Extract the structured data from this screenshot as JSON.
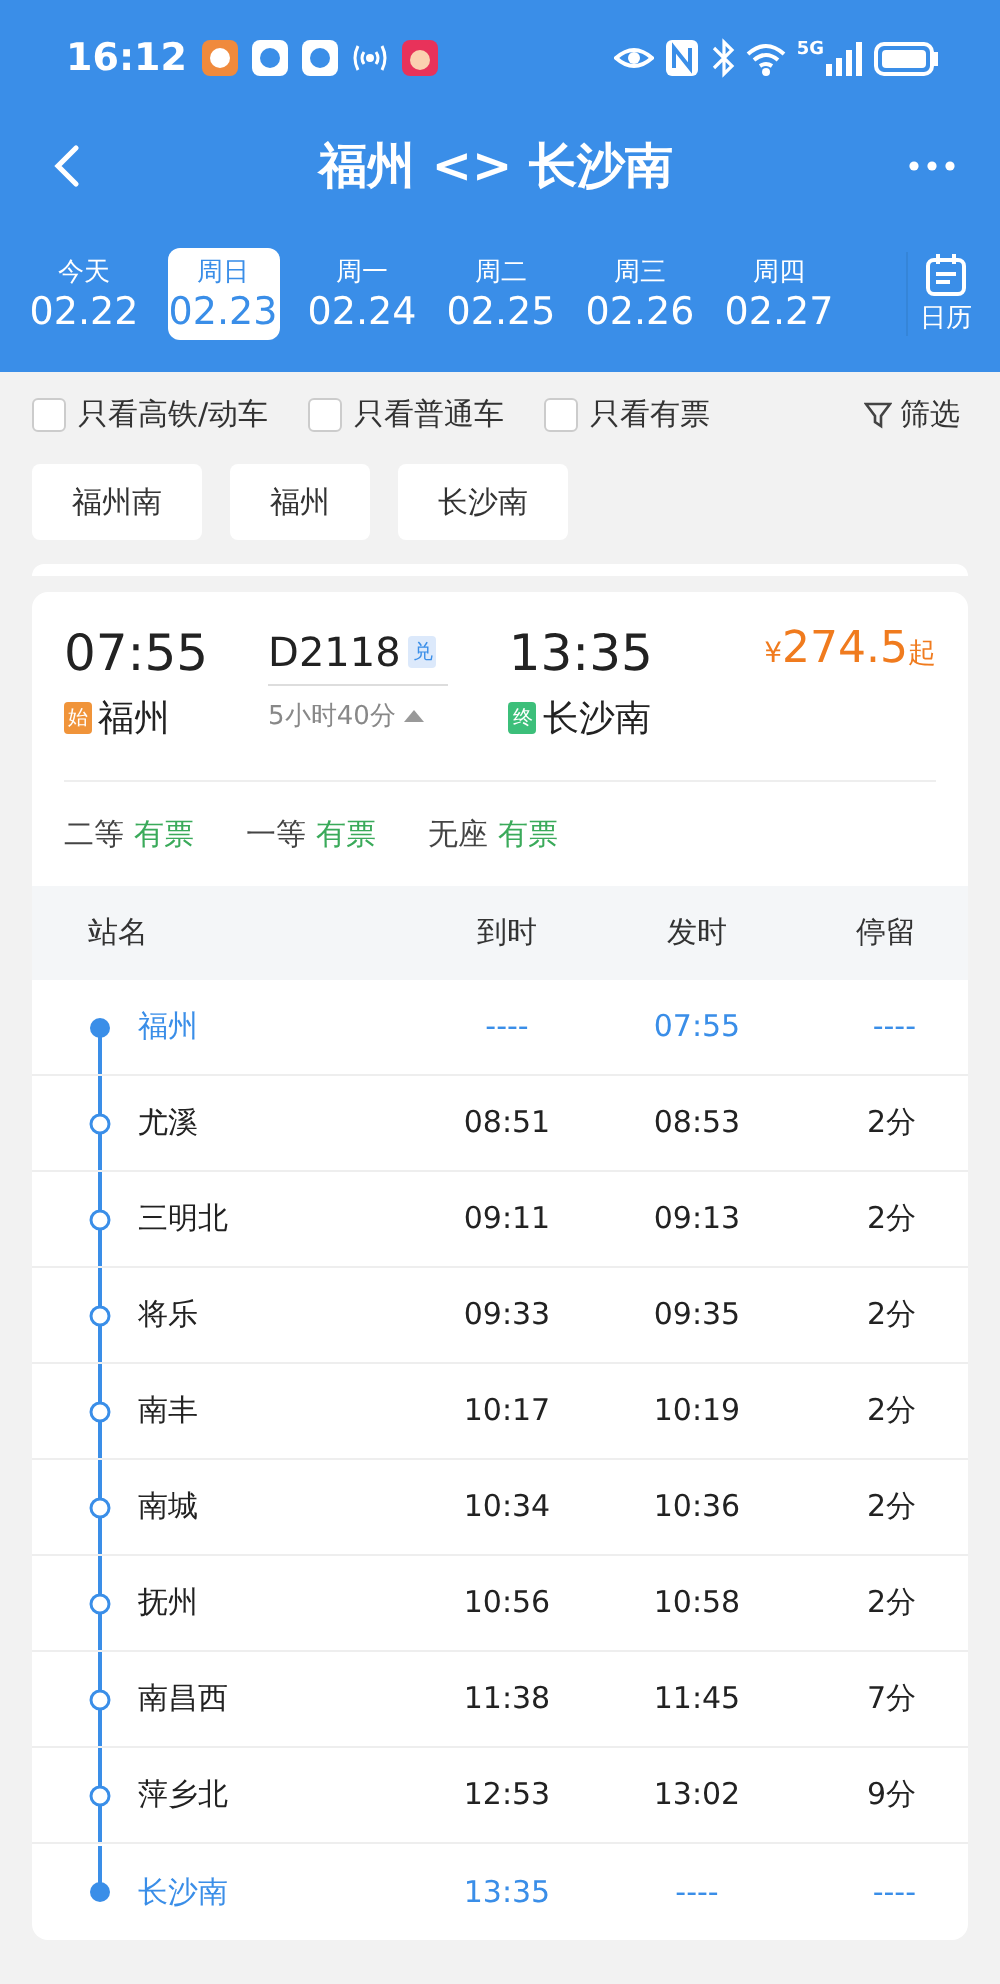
{
  "status_bar": {
    "time": "16:12",
    "network": "5G"
  },
  "header": {
    "title": "福州 <> 长沙南"
  },
  "dates": [
    {
      "weekday": "今天",
      "date": "02.22",
      "selected": false
    },
    {
      "weekday": "周日",
      "date": "02.23",
      "selected": true
    },
    {
      "weekday": "周一",
      "date": "02.24",
      "selected": false
    },
    {
      "weekday": "周二",
      "date": "02.25",
      "selected": false
    },
    {
      "weekday": "周三",
      "date": "02.26",
      "selected": false
    },
    {
      "weekday": "周四",
      "date": "02.27",
      "selected": false
    }
  ],
  "calendar_label": "日历",
  "filters": [
    {
      "label": "只看高铁/动车",
      "checked": false
    },
    {
      "label": "只看普通车",
      "checked": false
    },
    {
      "label": "只看有票",
      "checked": false
    }
  ],
  "filter_button": "筛选",
  "station_chips": [
    "福州南",
    "福州",
    "长沙南"
  ],
  "train": {
    "depart_time": "07:55",
    "number": "D2118",
    "badge": "兑",
    "arrive_time": "13:35",
    "price_symbol": "¥",
    "price": "274.5",
    "price_suffix": "起",
    "from_tag": "始",
    "from": "福州",
    "duration": "5小时40分",
    "expanded": true,
    "to_tag": "终",
    "to": "长沙南",
    "seats": [
      {
        "class": "二等",
        "availability": "有票"
      },
      {
        "class": "一等",
        "availability": "有票"
      },
      {
        "class": "无座",
        "availability": "有票"
      }
    ]
  },
  "stops_table": {
    "columns": [
      "站名",
      "到时",
      "发时",
      "停留"
    ],
    "rows": [
      {
        "kind": "terminal",
        "station": "福州",
        "arrive": "----",
        "depart": "07:55",
        "stay": "----"
      },
      {
        "kind": "stop",
        "station": "尤溪",
        "arrive": "08:51",
        "depart": "08:53",
        "stay": "2分"
      },
      {
        "kind": "stop",
        "station": "三明北",
        "arrive": "09:11",
        "depart": "09:13",
        "stay": "2分"
      },
      {
        "kind": "stop",
        "station": "将乐",
        "arrive": "09:33",
        "depart": "09:35",
        "stay": "2分"
      },
      {
        "kind": "stop",
        "station": "南丰",
        "arrive": "10:17",
        "depart": "10:19",
        "stay": "2分"
      },
      {
        "kind": "stop",
        "station": "南城",
        "arrive": "10:34",
        "depart": "10:36",
        "stay": "2分"
      },
      {
        "kind": "stop",
        "station": "抚州",
        "arrive": "10:56",
        "depart": "10:58",
        "stay": "2分"
      },
      {
        "kind": "stop",
        "station": "南昌西",
        "arrive": "11:38",
        "depart": "11:45",
        "stay": "7分"
      },
      {
        "kind": "stop",
        "station": "萍乡北",
        "arrive": "12:53",
        "depart": "13:02",
        "stay": "9分"
      },
      {
        "kind": "terminal",
        "station": "长沙南",
        "arrive": "13:35",
        "depart": "----",
        "stay": "----"
      }
    ]
  }
}
